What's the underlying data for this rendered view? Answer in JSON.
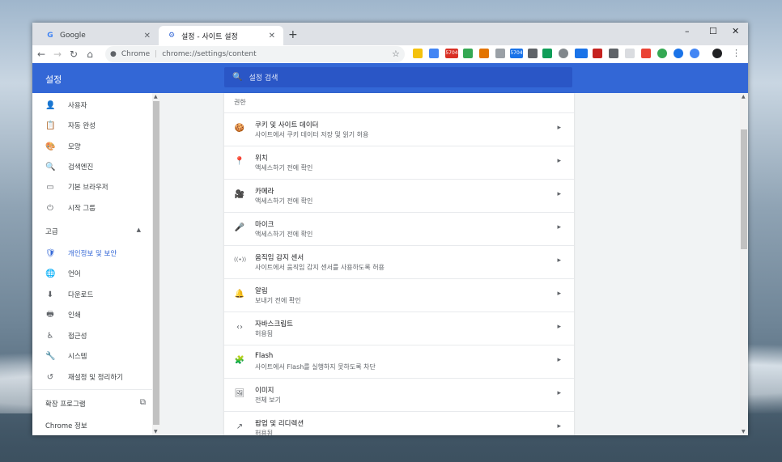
{
  "tabs": [
    {
      "label": "Google",
      "icon": "G"
    },
    {
      "label": "설정 - 사이트 설정",
      "icon": "⚙"
    }
  ],
  "window_controls": [
    "–",
    "☐",
    "✕"
  ],
  "toolbar": {
    "site_chip": "Chrome",
    "url": "chrome://settings/content",
    "badge_5704": "5704"
  },
  "header": {
    "title": "설정",
    "search_placeholder": "설정 검색"
  },
  "sidebar": {
    "items": [
      {
        "label": "사용자",
        "icon": "person-icon",
        "glyph": "👤"
      },
      {
        "label": "자동 완성",
        "icon": "clipboard-icon",
        "glyph": "📋"
      },
      {
        "label": "모양",
        "icon": "palette-icon",
        "glyph": "🎨"
      },
      {
        "label": "검색엔진",
        "icon": "search-icon",
        "glyph": "🔍"
      },
      {
        "label": "기본 브라우저",
        "icon": "browser-icon",
        "glyph": "▭"
      },
      {
        "label": "시작 그룹",
        "icon": "power-icon",
        "glyph": "⏻"
      }
    ],
    "advanced_label": "고급",
    "advanced_items": [
      {
        "label": "개인정보 및 보안",
        "icon": "shield-icon",
        "glyph": "🛡",
        "active": true
      },
      {
        "label": "언어",
        "icon": "globe-icon",
        "glyph": "🌐"
      },
      {
        "label": "다운로드",
        "icon": "download-icon",
        "glyph": "⬇"
      },
      {
        "label": "인쇄",
        "icon": "printer-icon",
        "glyph": "🖶"
      },
      {
        "label": "접근성",
        "icon": "accessibility-icon",
        "glyph": "♿"
      },
      {
        "label": "시스템",
        "icon": "wrench-icon",
        "glyph": "🔧"
      },
      {
        "label": "재설정 및 정리하기",
        "icon": "history-icon",
        "glyph": "↺"
      }
    ],
    "extensions_label": "확장 프로그램",
    "about_label": "Chrome 정보"
  },
  "content": {
    "section_label": "권한",
    "rows": [
      {
        "title": "쿠키 및 사이트 데이터",
        "subtitle": "사이트에서 쿠키 데이터 저장 및 읽기 허용",
        "icon": "cookie-icon",
        "glyph": "🍪"
      },
      {
        "title": "위치",
        "subtitle": "액세스하기 전에 확인",
        "icon": "location-icon",
        "glyph": "📍"
      },
      {
        "title": "카메라",
        "subtitle": "액세스하기 전에 확인",
        "icon": "camera-icon",
        "glyph": "🎥"
      },
      {
        "title": "마이크",
        "subtitle": "액세스하기 전에 확인",
        "icon": "microphone-icon",
        "glyph": "🎤"
      },
      {
        "title": "움직임 감지 센서",
        "subtitle": "사이트에서 움직임 감지 센서를 사용하도록 허용",
        "icon": "motion-sensor-icon",
        "glyph": "((•))"
      },
      {
        "title": "알림",
        "subtitle": "보내기 전에 확인",
        "icon": "bell-icon",
        "glyph": "🔔"
      },
      {
        "title": "자바스크립트",
        "subtitle": "허용됨",
        "icon": "code-icon",
        "glyph": "‹›"
      },
      {
        "title": "Flash",
        "subtitle": "사이트에서 Flash를 실행하지 못하도록 차단",
        "icon": "puzzle-icon",
        "glyph": "🧩"
      },
      {
        "title": "이미지",
        "subtitle": "전체 보기",
        "icon": "image-icon",
        "glyph": "🖼"
      },
      {
        "title": "팝업 및 리디렉션",
        "subtitle": "허용됨",
        "icon": "popup-icon",
        "glyph": "↗"
      }
    ]
  },
  "colors": {
    "accent": "#3367d6",
    "header_search": "#2a56c6"
  }
}
